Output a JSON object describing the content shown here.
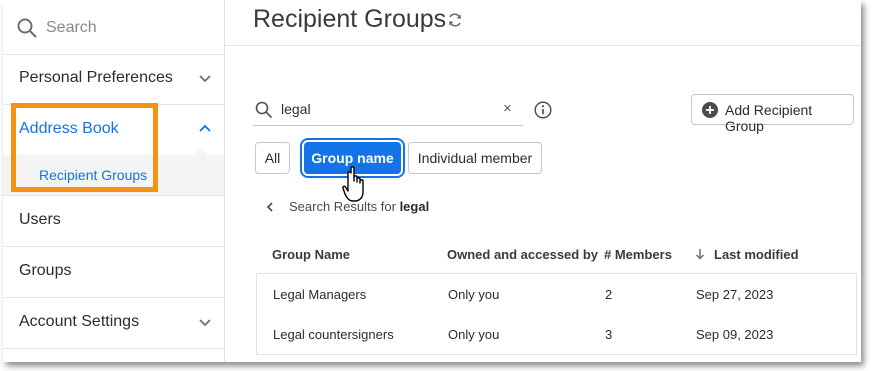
{
  "sidebar": {
    "search_placeholder": "Search",
    "items": [
      {
        "label": "Personal Preferences"
      },
      {
        "label": "Address Book"
      },
      {
        "label": "Users"
      },
      {
        "label": "Groups"
      },
      {
        "label": "Account Settings"
      }
    ],
    "sub_item": {
      "label": "Recipient Groups"
    }
  },
  "header": {
    "title": "Recipient Groups"
  },
  "filter": {
    "value": "legal",
    "clear": "×"
  },
  "add_button": {
    "label": "Add Recipient Group"
  },
  "segments": {
    "all": "All",
    "group_name": "Group name",
    "individual_member": "Individual member",
    "selected": "Group name"
  },
  "results": {
    "prefix": "Search Results for",
    "query": "legal"
  },
  "table": {
    "columns": [
      "Group Name",
      "Owned and accessed by",
      "# Members",
      "Last modified"
    ],
    "sort_column": "Last modified",
    "rows": [
      {
        "name": "Legal Managers",
        "owner": "Only you",
        "members": "2",
        "modified": "Sep 27, 2023"
      },
      {
        "name": "Legal countersigners",
        "owner": "Only you",
        "members": "3",
        "modified": "Sep 09, 2023"
      }
    ]
  },
  "colors": {
    "accent": "#1473e6",
    "highlight": "#f39214"
  },
  "icons": [
    "search-icon",
    "chevron-down-icon",
    "chevron-up-icon",
    "refresh-icon",
    "clear-icon",
    "info-icon",
    "add-icon",
    "chevron-left-icon",
    "sort-arrow-down-icon",
    "hand-pointer-icon"
  ]
}
